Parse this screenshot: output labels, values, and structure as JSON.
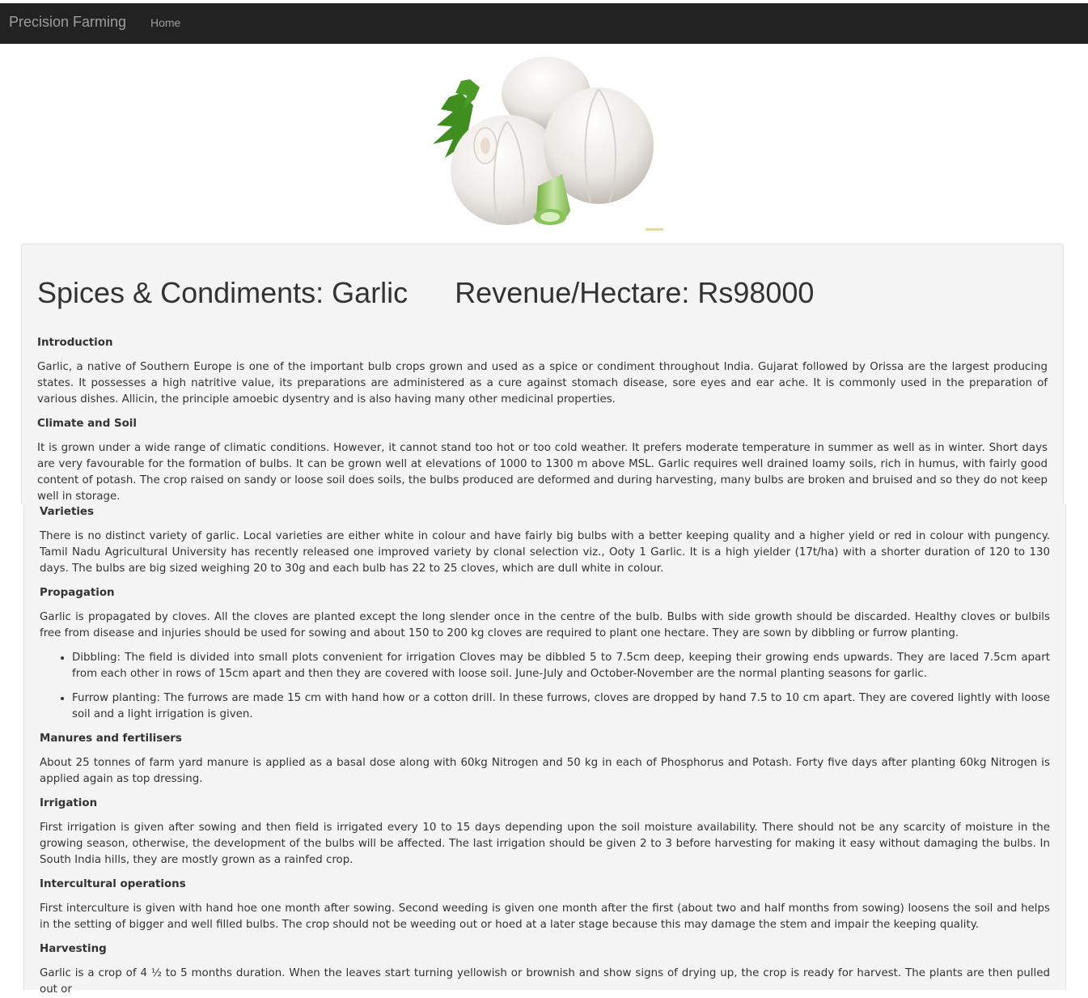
{
  "navbar": {
    "brand": "Precision Farming",
    "home": "Home",
    "background": "#222222",
    "text_color": "#9d9d9d"
  },
  "hero": {
    "image": "garlic-bulbs-with-parsley"
  },
  "header": {
    "category_title": "Spices & Condiments: Garlic",
    "revenue_title": "Revenue/Hectare: Rs98000"
  },
  "sections": {
    "introduction": {
      "heading": "Introduction",
      "text": "Garlic, a native of Southern Europe is one of the important bulb crops grown and used as a spice or condiment throughout India. Gujarat followed by Orissa are the largest producing states. It possesses a high natritive value, its preparations are administered as a cure against stomach disease, sore eyes and ear ache. It is commonly used in the preparation of various dishes. Allicin, the principle amoebic dysentry and is also having many other medicinal properties."
    },
    "climate": {
      "heading": "Climate and Soil",
      "text": "It is grown under a wide range of climatic conditions. However, it cannot stand too hot or too cold weather. It prefers moderate temperature in summer as well as in winter. Short days are very favourable for the formation of bulbs. It can be grown well at elevations of 1000 to 1300 m above MSL. Garlic requires well drained loamy soils, rich in humus, with fairly good content of potash. The crop raised on sandy or loose soil does soils, the bulbs produced are deformed and during harvesting, many bulbs are broken and bruised and so they do not keep well in storage."
    },
    "varieties": {
      "heading": "Varieties",
      "text": "There is no distinct variety of garlic. Local varieties are either white in colour and have fairly big bulbs with a better keeping quality and a higher yield or red in colour with pungency. Tamil Nadu Agricultural University has recently released one improved variety by clonal selection viz., Ooty 1 Garlic. It is a high yielder (17t/ha) with a shorter duration of 120 to 130 days. The bulbs are big sized weighing 20 to 30g and each bulb has 22 to 25 cloves, which are dull white in colour."
    },
    "propagation": {
      "heading": "Propagation",
      "text": "Garlic is propagated by cloves. All the cloves are planted except the long slender once in the centre of the bulb. Bulbs with side growth should be discarded. Healthy cloves or bulbils free from disease and injuries should be used for sowing and about 150 to 200 kg cloves are required to plant one hectare. They are sown by dibbling or furrow planting.",
      "bullets": [
        "Dibbling: The field is divided into small plots convenient for irrigation Cloves may be dibbled 5 to 7.5cm deep, keeping their growing ends upwards. They are laced 7.5cm apart from each other in rows of 15cm apart and then they are covered with loose soil. June-July and October-November are the normal planting seasons for garlic.",
        "Furrow planting: The furrows are made 15 cm with hand how or a cotton drill. In these furrows, cloves are dropped by hand 7.5 to 10 cm apart. They are covered lightly with loose soil and a light irrigation is given."
      ]
    },
    "manures": {
      "heading": "Manures and fertilisers",
      "text": "About 25 tonnes of farm yard manure is applied as a basal dose along with 60kg Nitrogen and 50 kg in each of Phosphorus and Potash. Forty five days after planting 60kg Nitrogen is applied again as top dressing."
    },
    "irrigation": {
      "heading": "Irrigation",
      "text": "First irrigation is given after sowing and then field is irrigated every 10 to 15 days depending upon the soil moisture availability. There should not be any scarcity of moisture in the growing season, otherwise, the development of the bulbs will be affected. The last irrigation should be given 2 to 3 before harvesting for making it easy without damaging the bulbs. In South India hills, they are mostly grown as a rainfed crop."
    },
    "intercultural": {
      "heading": "Intercultural operations",
      "text": "First interculture is given with hand hoe one month after sowing. Second weeding is given one month after the first (about two and half months from sowing) loosens the soil and helps in the setting of bigger and well filled bulbs. The crop should not be weeding out or hoed at a later stage because this may damage the stem and impair the keeping quality."
    },
    "harvesting": {
      "heading": "Harvesting",
      "text": "Garlic is a crop of 4 ½ to 5 months duration. When the leaves start turning yellowish or brownish and show signs of drying up, the crop is ready for harvest. The plants are then pulled out or"
    }
  },
  "colors": {
    "panel_bg": "#f4f4f4",
    "text": "#333333"
  }
}
